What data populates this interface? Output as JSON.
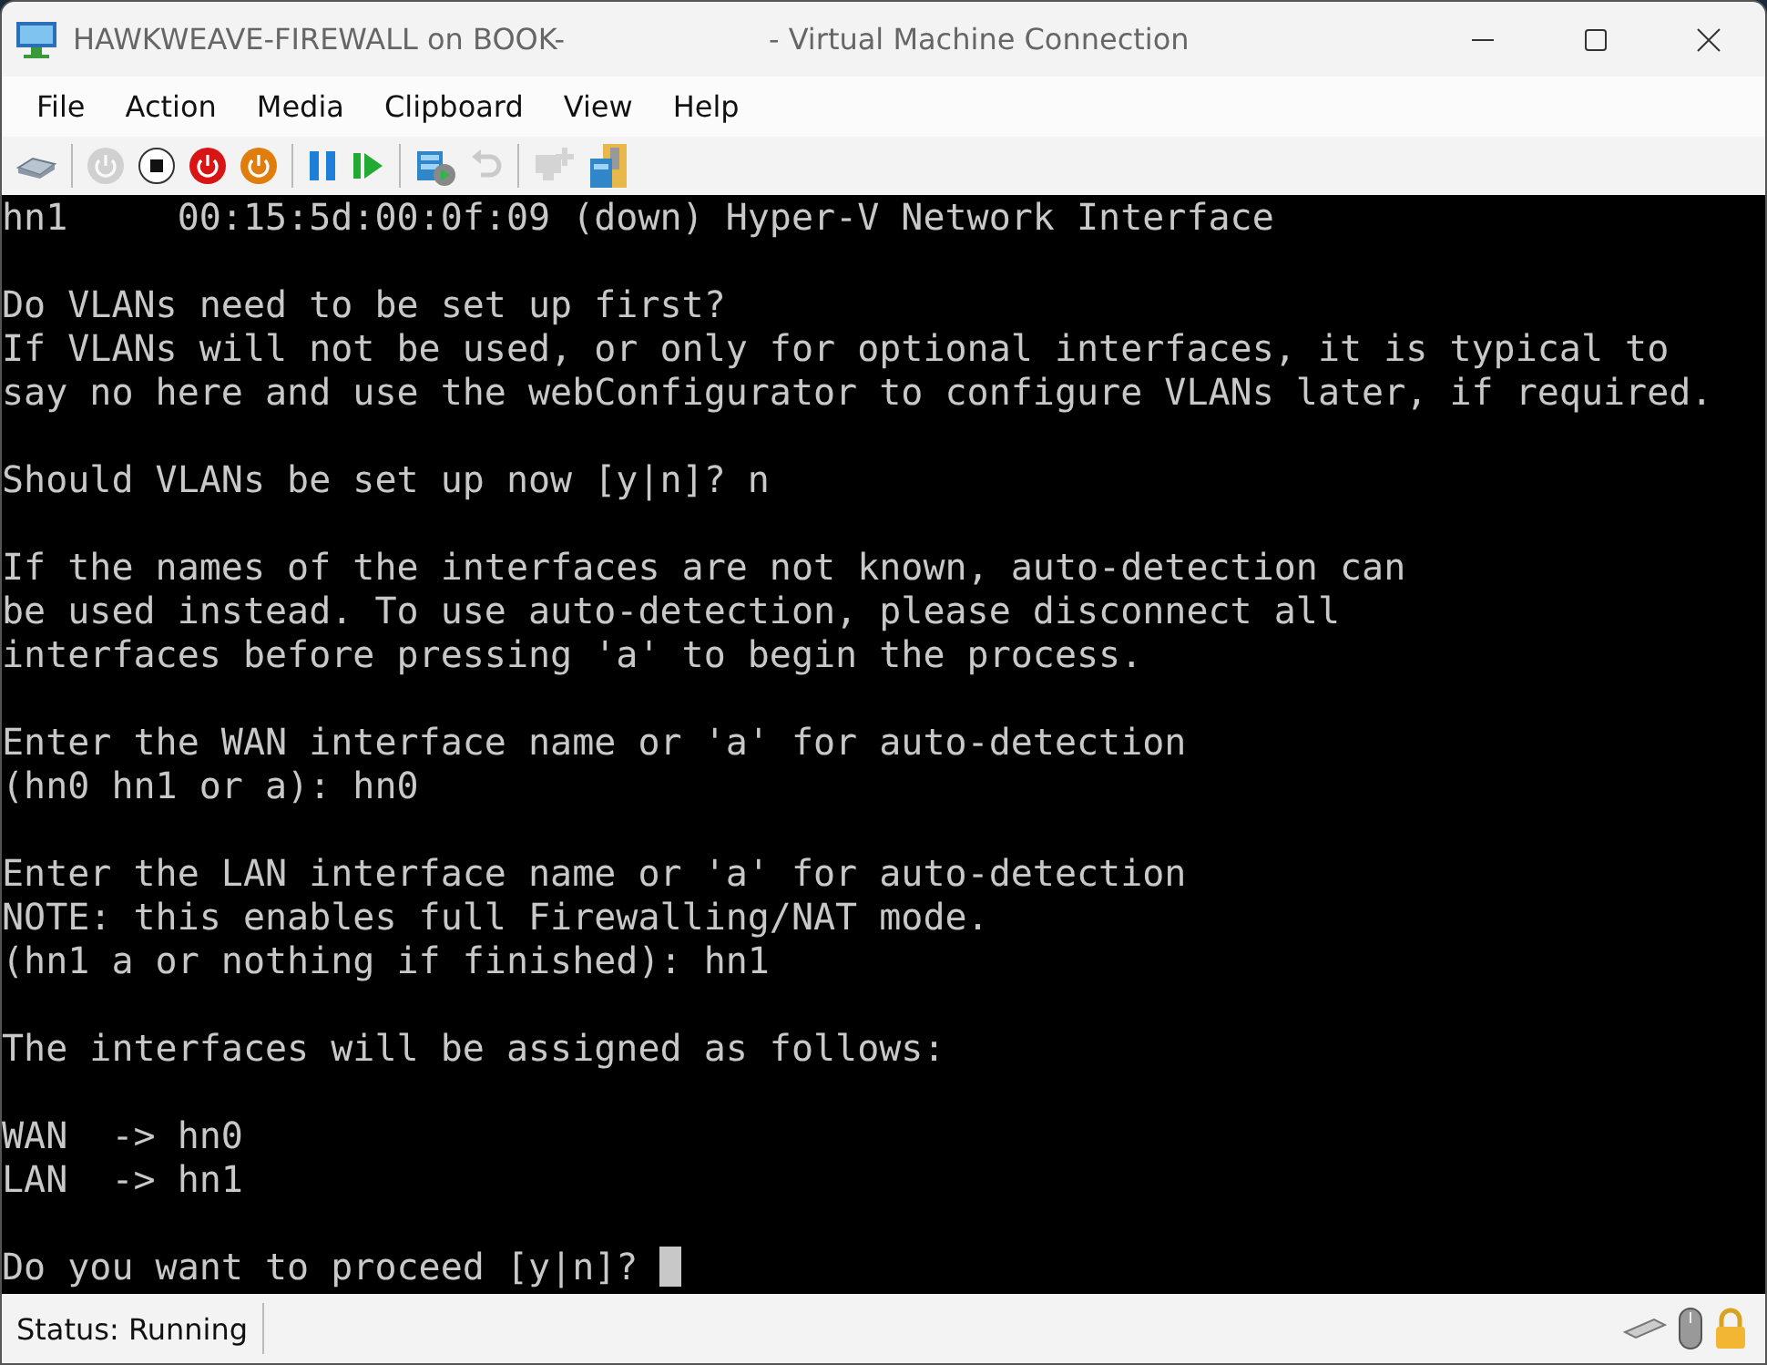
{
  "window": {
    "title": "HAWKWEAVE-FIREWALL on BOOK-",
    "title_suffix": "- Virtual Machine Connection"
  },
  "menu": [
    "File",
    "Action",
    "Media",
    "Clipboard",
    "View",
    "Help"
  ],
  "toolbar_groups": [
    [
      {
        "kind": "ctrl-alt-del",
        "disabled": false
      }
    ],
    [
      {
        "kind": "start",
        "disabled": true
      },
      {
        "kind": "turn-off",
        "disabled": false
      },
      {
        "kind": "shut-down",
        "disabled": false
      },
      {
        "kind": "save",
        "disabled": false
      }
    ],
    [
      {
        "kind": "pause",
        "disabled": false
      },
      {
        "kind": "reset",
        "disabled": false
      }
    ],
    [
      {
        "kind": "checkpoint",
        "disabled": false
      },
      {
        "kind": "revert",
        "disabled": true
      }
    ],
    [
      {
        "kind": "enhanced-session",
        "disabled": true
      },
      {
        "kind": "share",
        "disabled": false
      }
    ]
  ],
  "console": {
    "paragraphs": [
      [
        "hn1     00:15:5d:00:0f:09 (down) Hyper-V Network Interface"
      ],
      [
        "Do VLANs need to be set up first?",
        "If VLANs will not be used, or only for optional interfaces, it is typical to",
        "say no here and use the webConfigurator to configure VLANs later, if required."
      ],
      [
        "Should VLANs be set up now [y|n]? n"
      ],
      [
        "If the names of the interfaces are not known, auto-detection can",
        "be used instead. To use auto-detection, please disconnect all",
        "interfaces before pressing 'a' to begin the process."
      ],
      [
        "Enter the WAN interface name or 'a' for auto-detection",
        "(hn0 hn1 or a): hn0"
      ],
      [
        "Enter the LAN interface name or 'a' for auto-detection",
        "NOTE: this enables full Firewalling/NAT mode.",
        "(hn1 a or nothing if finished): hn1"
      ],
      [
        "The interfaces will be assigned as follows:"
      ],
      [
        "WAN  -> hn0",
        "LAN  -> hn1"
      ]
    ],
    "prompt": "Do you want to proceed [y|n]? ",
    "cursor": true
  },
  "status_bar": {
    "status": "Status: Running"
  }
}
